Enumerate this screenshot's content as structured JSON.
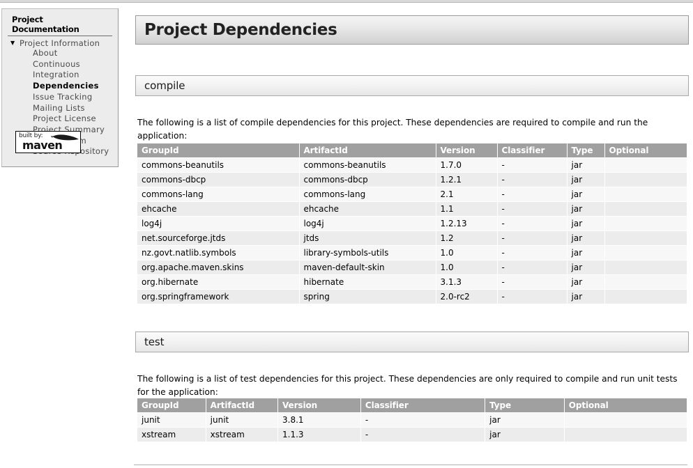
{
  "sidebar": {
    "heading": "Project Documentation",
    "tree_root_label": "Project Information",
    "tree_arrow_glyph": "▼",
    "items": [
      {
        "label": "About",
        "current": false
      },
      {
        "label": "Continuous",
        "current": false
      },
      {
        "label": "Integration",
        "current": false
      },
      {
        "label": "Dependencies",
        "current": true
      },
      {
        "label": "Issue Tracking",
        "current": false
      },
      {
        "label": "Mailing Lists",
        "current": false
      },
      {
        "label": "Project License",
        "current": false
      },
      {
        "label": "Project Summary",
        "current": false
      },
      {
        "label": "Project Team",
        "current": false
      },
      {
        "label": "Source Repository",
        "current": false
      }
    ],
    "logo": {
      "built_by": "built by:",
      "maven": "maven"
    }
  },
  "page": {
    "title": "Project Dependencies"
  },
  "sections": [
    {
      "id": "compile",
      "heading": "compile",
      "description": "The following is a list of compile dependencies for this project. These dependencies are required to compile and run the application:",
      "columns": [
        "GroupId",
        "ArtifactId",
        "Version",
        "Classifier",
        "Type",
        "Optional"
      ],
      "rows": [
        [
          "commons-beanutils",
          "commons-beanutils",
          "1.7.0",
          "-",
          "jar",
          ""
        ],
        [
          "commons-dbcp",
          "commons-dbcp",
          "1.2.1",
          "-",
          "jar",
          ""
        ],
        [
          "commons-lang",
          "commons-lang",
          "2.1",
          "-",
          "jar",
          ""
        ],
        [
          "ehcache",
          "ehcache",
          "1.1",
          "-",
          "jar",
          ""
        ],
        [
          "log4j",
          "log4j",
          "1.2.13",
          "-",
          "jar",
          ""
        ],
        [
          "net.sourceforge.jtds",
          "jtds",
          "1.2",
          "-",
          "jar",
          ""
        ],
        [
          "nz.govt.natlib.symbols",
          "library-symbols-utils",
          "1.0",
          "-",
          "jar",
          ""
        ],
        [
          "org.apache.maven.skins",
          "maven-default-skin",
          "1.0",
          "-",
          "jar",
          ""
        ],
        [
          "org.hibernate",
          "hibernate",
          "3.1.3",
          "-",
          "jar",
          ""
        ],
        [
          "org.springframework",
          "spring",
          "2.0-rc2",
          "-",
          "jar",
          ""
        ]
      ]
    },
    {
      "id": "test",
      "heading": "test",
      "description": "The following is a list of test dependencies for this project. These dependencies are only required to compile and run unit tests for the application:",
      "columns": [
        "GroupId",
        "ArtifactId",
        "Version",
        "Classifier",
        "Type",
        "Optional"
      ],
      "rows": [
        [
          "junit",
          "junit",
          "3.8.1",
          "-",
          "jar",
          ""
        ],
        [
          "xstream",
          "xstream",
          "1.1.3",
          "-",
          "jar",
          ""
        ]
      ]
    }
  ],
  "colors": {
    "table_header_bg": "#a0a0a0",
    "row_odd_bg": "#ececec",
    "row_even_bg": "#f7f7f7",
    "panel_bg": "#ececec"
  }
}
